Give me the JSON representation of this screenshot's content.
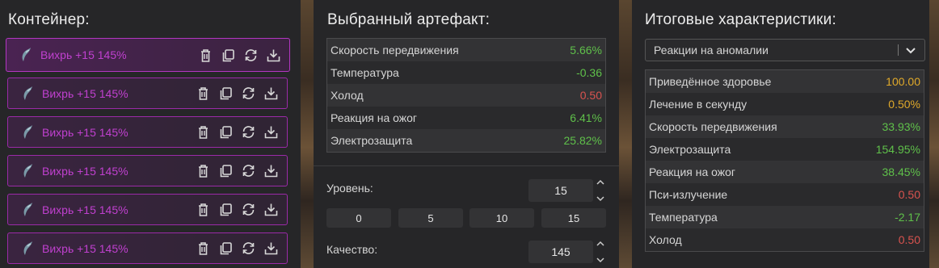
{
  "container": {
    "title": "Контейнер:",
    "items": [
      {
        "label": "Вихрь +15 145%"
      },
      {
        "label": "Вихрь +15 145%"
      },
      {
        "label": "Вихрь +15 145%"
      },
      {
        "label": "Вихрь +15 145%"
      },
      {
        "label": "Вихрь +15 145%"
      },
      {
        "label": "Вихрь +15 145%"
      }
    ],
    "actions": [
      "trash-icon",
      "copy-icon",
      "refresh-icon",
      "download-icon"
    ]
  },
  "selected": {
    "title": "Выбранный артефакт:",
    "stats": [
      {
        "name": "Скорость передвижения",
        "value": "5.66%",
        "tone": "green"
      },
      {
        "name": "Температура",
        "value": "-0.36",
        "tone": "green"
      },
      {
        "name": "Холод",
        "value": "0.50",
        "tone": "red"
      },
      {
        "name": "Реакция на ожог",
        "value": "6.41%",
        "tone": "green"
      },
      {
        "name": "Электрозащита",
        "value": "25.82%",
        "tone": "green"
      }
    ],
    "level": {
      "label": "Уровень:",
      "value": "15",
      "presets": [
        "0",
        "5",
        "10",
        "15"
      ]
    },
    "quality": {
      "label": "Качество:",
      "value": "145"
    }
  },
  "totals": {
    "title": "Итоговые характеристики:",
    "select_value": "Реакции на аномалии",
    "stats": [
      {
        "name": "Приведённое здоровье",
        "value": "100.00",
        "tone": "yellow"
      },
      {
        "name": "Лечение в секунду",
        "value": "0.50%",
        "tone": "yellow"
      },
      {
        "name": "Скорость передвижения",
        "value": "33.93%",
        "tone": "green"
      },
      {
        "name": "Электрозащита",
        "value": "154.95%",
        "tone": "green"
      },
      {
        "name": "Реакция на ожог",
        "value": "38.45%",
        "tone": "green"
      },
      {
        "name": "Пси-излучение",
        "value": "0.50",
        "tone": "red"
      },
      {
        "name": "Температура",
        "value": "-2.17",
        "tone": "green"
      },
      {
        "name": "Холод",
        "value": "0.50",
        "tone": "red"
      }
    ]
  },
  "colors": {
    "accent": "#b336c2",
    "green": "#5fc04a",
    "red": "#d9534f",
    "yellow": "#e0a92a"
  }
}
